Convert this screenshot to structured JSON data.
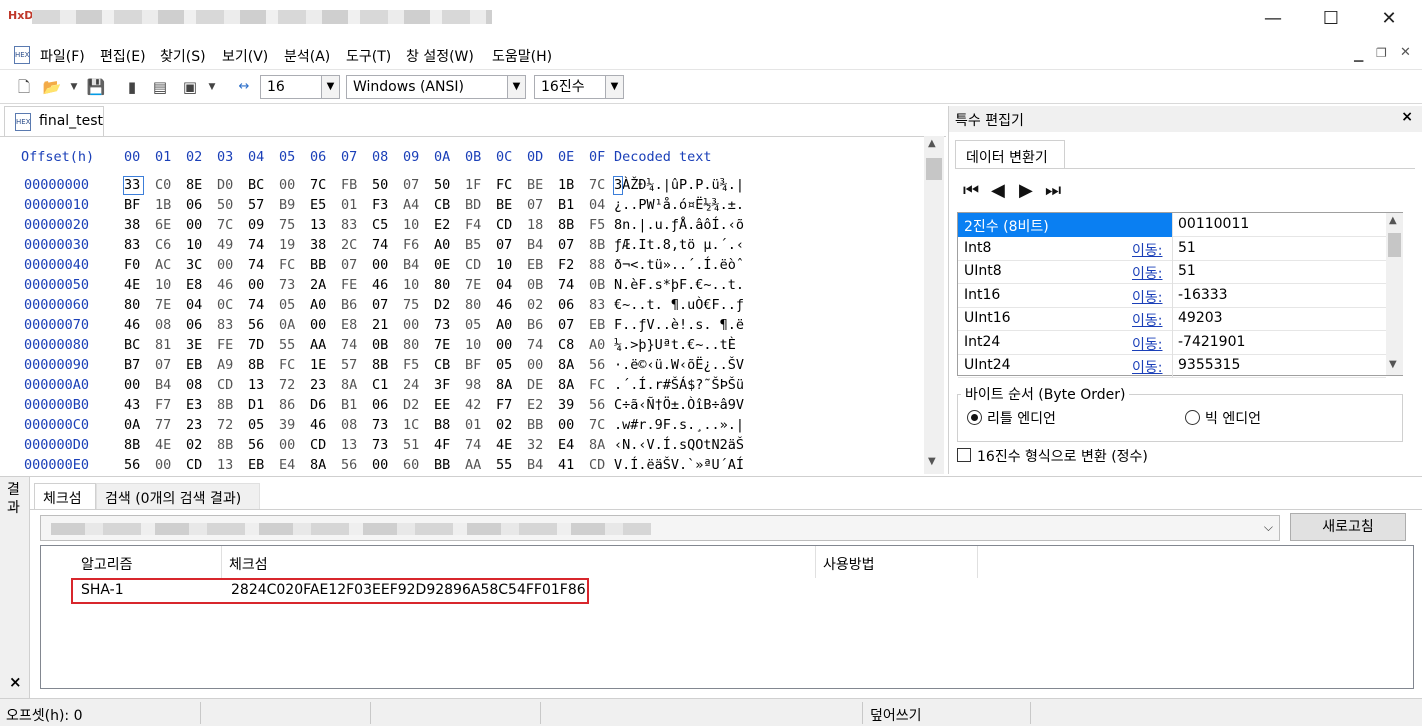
{
  "window": {
    "minimize_glyph": "—",
    "maximize_glyph": "☐",
    "close_glyph": "✕"
  },
  "menu": [
    "파일(F)",
    "편집(E)",
    "찾기(S)",
    "보기(V)",
    "분석(A)",
    "도구(T)",
    "창 설정(W)",
    "도움말(H)"
  ],
  "toolbar": {
    "bytes_per_row": "16",
    "charset": "Windows (ANSI)",
    "offset_base": "16진수"
  },
  "document_tab": {
    "label": "final_test"
  },
  "hex": {
    "header": {
      "offset": "Offset(h)",
      "columns": [
        "00",
        "01",
        "02",
        "03",
        "04",
        "05",
        "06",
        "07",
        "08",
        "09",
        "0A",
        "0B",
        "0C",
        "0D",
        "0E",
        "0F"
      ],
      "decoded": "Decoded text"
    },
    "rows": [
      {
        "offset": "00000000",
        "bytes": [
          "33",
          "C0",
          "8E",
          "D0",
          "BC",
          "00",
          "7C",
          "FB",
          "50",
          "07",
          "50",
          "1F",
          "FC",
          "BE",
          "1B",
          "7C"
        ],
        "text": "3ÀŽÐ¼.|ûP.P.ü¾.|"
      },
      {
        "offset": "00000010",
        "bytes": [
          "BF",
          "1B",
          "06",
          "50",
          "57",
          "B9",
          "E5",
          "01",
          "F3",
          "A4",
          "CB",
          "BD",
          "BE",
          "07",
          "B1",
          "04"
        ],
        "text": "¿..PW¹å.ó¤Ë½¾.±."
      },
      {
        "offset": "00000020",
        "bytes": [
          "38",
          "6E",
          "00",
          "7C",
          "09",
          "75",
          "13",
          "83",
          "C5",
          "10",
          "E2",
          "F4",
          "CD",
          "18",
          "8B",
          "F5"
        ],
        "text": "8n.|.u.ƒÅ.âôÍ.‹õ"
      },
      {
        "offset": "00000030",
        "bytes": [
          "83",
          "C6",
          "10",
          "49",
          "74",
          "19",
          "38",
          "2C",
          "74",
          "F6",
          "A0",
          "B5",
          "07",
          "B4",
          "07",
          "8B"
        ],
        "text": "ƒÆ.It.8,tö µ.´.‹"
      },
      {
        "offset": "00000040",
        "bytes": [
          "F0",
          "AC",
          "3C",
          "00",
          "74",
          "FC",
          "BB",
          "07",
          "00",
          "B4",
          "0E",
          "CD",
          "10",
          "EB",
          "F2",
          "88"
        ],
        "text": "ð¬<.tü»..´.Í.ëòˆ"
      },
      {
        "offset": "00000050",
        "bytes": [
          "4E",
          "10",
          "E8",
          "46",
          "00",
          "73",
          "2A",
          "FE",
          "46",
          "10",
          "80",
          "7E",
          "04",
          "0B",
          "74",
          "0B"
        ],
        "text": "N.èF.s*þF.€~..t."
      },
      {
        "offset": "00000060",
        "bytes": [
          "80",
          "7E",
          "04",
          "0C",
          "74",
          "05",
          "A0",
          "B6",
          "07",
          "75",
          "D2",
          "80",
          "46",
          "02",
          "06",
          "83"
        ],
        "text": "€~..t. ¶.uÒ€F..ƒ"
      },
      {
        "offset": "00000070",
        "bytes": [
          "46",
          "08",
          "06",
          "83",
          "56",
          "0A",
          "00",
          "E8",
          "21",
          "00",
          "73",
          "05",
          "A0",
          "B6",
          "07",
          "EB"
        ],
        "text": "F..ƒV..è!.s. ¶.ë"
      },
      {
        "offset": "00000080",
        "bytes": [
          "BC",
          "81",
          "3E",
          "FE",
          "7D",
          "55",
          "AA",
          "74",
          "0B",
          "80",
          "7E",
          "10",
          "00",
          "74",
          "C8",
          "A0"
        ],
        "text": "¼.>þ}Uªt.€~..tÈ "
      },
      {
        "offset": "00000090",
        "bytes": [
          "B7",
          "07",
          "EB",
          "A9",
          "8B",
          "FC",
          "1E",
          "57",
          "8B",
          "F5",
          "CB",
          "BF",
          "05",
          "00",
          "8A",
          "56"
        ],
        "text": "·.ë©‹ü.W‹õË¿..ŠV"
      },
      {
        "offset": "000000A0",
        "bytes": [
          "00",
          "B4",
          "08",
          "CD",
          "13",
          "72",
          "23",
          "8A",
          "C1",
          "24",
          "3F",
          "98",
          "8A",
          "DE",
          "8A",
          "FC"
        ],
        "text": ".´.Í.r#ŠÁ$?˜ŠÞŠü"
      },
      {
        "offset": "000000B0",
        "bytes": [
          "43",
          "F7",
          "E3",
          "8B",
          "D1",
          "86",
          "D6",
          "B1",
          "06",
          "D2",
          "EE",
          "42",
          "F7",
          "E2",
          "39",
          "56"
        ],
        "text": "C÷ã‹Ñ†Ö±.ÒîB÷â9V"
      },
      {
        "offset": "000000C0",
        "bytes": [
          "0A",
          "77",
          "23",
          "72",
          "05",
          "39",
          "46",
          "08",
          "73",
          "1C",
          "B8",
          "01",
          "02",
          "BB",
          "00",
          "7C"
        ],
        "text": ".w#r.9F.s.¸..».|"
      },
      {
        "offset": "000000D0",
        "bytes": [
          "8B",
          "4E",
          "02",
          "8B",
          "56",
          "00",
          "CD",
          "13",
          "73",
          "51",
          "4F",
          "74",
          "4E",
          "32",
          "E4",
          "8A"
        ],
        "text": "‹N.‹V.Í.sQOtN2äŠ"
      },
      {
        "offset": "000000E0",
        "bytes": [
          "56",
          "00",
          "CD",
          "13",
          "EB",
          "E4",
          "8A",
          "56",
          "00",
          "60",
          "BB",
          "AA",
          "55",
          "B4",
          "41",
          "CD"
        ],
        "text": "V.Í.ëäŠV.`»ªU´AÍ"
      }
    ]
  },
  "side_panel": {
    "title": "특수 편집기",
    "close_glyph": "×",
    "subtab": "데이터 변환기",
    "rows": [
      {
        "type": "2진수 (8비트)",
        "move": "",
        "value": "00110011"
      },
      {
        "type": "Int8",
        "move": "이동:",
        "value": "51"
      },
      {
        "type": "UInt8",
        "move": "이동:",
        "value": "51"
      },
      {
        "type": "Int16",
        "move": "이동:",
        "value": "-16333"
      },
      {
        "type": "UInt16",
        "move": "이동:",
        "value": "49203"
      },
      {
        "type": "Int24",
        "move": "이동:",
        "value": "-7421901"
      },
      {
        "type": "UInt24",
        "move": "이동:",
        "value": "9355315"
      }
    ],
    "byte_order_label": "바이트 순서 (Byte Order)",
    "little_endian": "리틀 엔디언",
    "big_endian": "빅 엔디언",
    "hex_checkbox": "16진수 형식으로 변환 (정수)"
  },
  "bottom": {
    "side_label": "결과",
    "close_glyph": "×",
    "tabs": [
      "체크섬",
      "검색 (0개의 검색 결과)"
    ],
    "refresh_button": "새로고침",
    "columns": [
      "알고리즘",
      "체크섬",
      "사용방법"
    ],
    "rows": [
      {
        "algorithm": "SHA-1",
        "checksum": "2824C020FAE12F03EEF92D92896A58C54FF01F86",
        "usage": ""
      }
    ]
  },
  "status": {
    "offset": "오프셋(h): 0",
    "mode": "덮어쓰기"
  },
  "colors": {
    "accent": "#0a7ff2",
    "hex_blue": "#1a3fb8",
    "highlight_red": "#d8262c"
  }
}
